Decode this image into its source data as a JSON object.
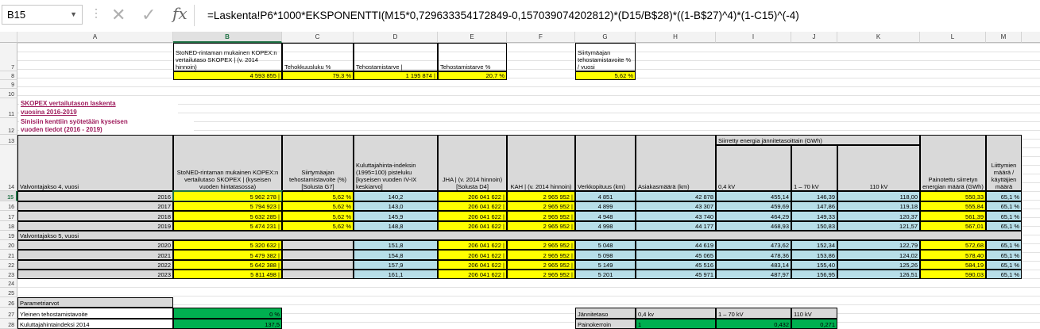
{
  "formula_bar": {
    "name_box": "B15",
    "formula": "=Laskenta!P6*1000*EKSPONENTTI(M15*0,729633354172849-0,157039074202812)*(D15/B$28)*((1-B$27)^4)*(1-C15)^(-4)"
  },
  "columns": [
    "A",
    "B",
    "C",
    "D",
    "E",
    "F",
    "G",
    "H",
    "I",
    "J",
    "K",
    "L",
    "M"
  ],
  "rows": [
    "7",
    "8",
    "9",
    "10",
    "11",
    "12",
    "13",
    "14",
    "15",
    "16",
    "17",
    "18",
    "19",
    "20",
    "21",
    "22",
    "23",
    "24",
    "25",
    "26",
    "27",
    "28"
  ],
  "top_block": {
    "b7": "StoNED-rintaman mukainen KOPEX:n vertailutaso SKOPEX | (v. 2014 hinnoin)",
    "c7": "Tehokkuusluku %",
    "d7": "Tehostamistarve |",
    "e7": "Tehostamistarve %",
    "g7": "Siirtymäajan tehostamistavoite % / vuosi",
    "b8": "4 593 855 |",
    "c8": "79,3 %",
    "d8": "1 195 874 |",
    "e8": "20,7 %",
    "g8": "5,62 %"
  },
  "section_title": {
    "line1": "SKOPEX vertailutason laskenta",
    "line2": "vuosina 2016-2019",
    "line3": "Sinisiin kenttiin syötetään kyseisen",
    "line4": "vuoden tiedot (2016 - 2019)"
  },
  "headers": {
    "a14": "Valvontajakso 4,   vuosi",
    "b14": "StoNED-rintaman mukainen KOPEX:n vertailutaso SKOPEX | (kyseisen vuoden hintatasossa)",
    "c14": "Siirtymäajan tehostamistavoite (%) [Solusta G7]",
    "d14": "Kuluttajahinta-indeksin (1995=100) pisteluku [kyseisen vuoden IV-IX keskiarvo]",
    "e14": "JHA | (v. 2014 hinnoin) [Solusta D4]",
    "f14": "KAH | (v. 2014 hinnoin)",
    "g14": "Verkkopituus (km)",
    "h14": "Asiakasmäärä (km)",
    "i13": "Siirretty energia jännitetasoittain (GWh)",
    "i14": "0,4 kV",
    "j14": "1 – 70 kV",
    "k14": "110 kV",
    "l14": "Painotettu siirretyn energian määrä (GWh)",
    "m14": "Liittymien määrä / käyttäjien määrä"
  },
  "period4": [
    {
      "year": "2016",
      "b": "5 962 278 |",
      "c": "5,62 %",
      "d": "140,2",
      "e": "206 041 622 |",
      "f": "2 965 952 |",
      "g": "4 851",
      "h": "42 878",
      "i": "455,14",
      "j": "146,39",
      "k": "118,00",
      "l": "550,33",
      "m": "65,1 %"
    },
    {
      "year": "2017",
      "b": "5 794 923 |",
      "c": "5,62 %",
      "d": "143,0",
      "e": "206 041 622 |",
      "f": "2 965 952 |",
      "g": "4 899",
      "h": "43 307",
      "i": "459,69",
      "j": "147,86",
      "k": "119,18",
      "l": "555,84",
      "m": "65,1 %"
    },
    {
      "year": "2018",
      "b": "5 632 285 |",
      "c": "5,62 %",
      "d": "145,9",
      "e": "206 041 622 |",
      "f": "2 965 952 |",
      "g": "4 948",
      "h": "43 740",
      "i": "464,29",
      "j": "149,33",
      "k": "120,37",
      "l": "561,39",
      "m": "65,1 %"
    },
    {
      "year": "2019",
      "b": "5 474 231 |",
      "c": "5,62 %",
      "d": "148,8",
      "e": "206 041 622 |",
      "f": "2 965 952 |",
      "g": "4 998",
      "h": "44 177",
      "i": "468,93",
      "j": "150,83",
      "k": "121,57",
      "l": "567,01",
      "m": "65,1 %"
    }
  ],
  "period5_label": "Valvontajakso 5,   vuosi",
  "period5": [
    {
      "year": "2020",
      "b": "5 320 632 |",
      "c": "",
      "d": "151,8",
      "e": "206 041 622 |",
      "f": "2 965 952 |",
      "g": "5 048",
      "h": "44 619",
      "i": "473,62",
      "j": "152,34",
      "k": "122,79",
      "l": "572,68",
      "m": "65,1 %"
    },
    {
      "year": "2021",
      "b": "5 479 382 |",
      "c": "",
      "d": "154,8",
      "e": "206 041 622 |",
      "f": "2 965 952 |",
      "g": "5 098",
      "h": "45 065",
      "i": "478,36",
      "j": "153,86",
      "k": "124,02",
      "l": "578,40",
      "m": "65,1 %"
    },
    {
      "year": "2022",
      "b": "5 642 388 |",
      "c": "",
      "d": "157,9",
      "e": "206 041 622 |",
      "f": "2 965 952 |",
      "g": "5 149",
      "h": "45 516",
      "i": "483,14",
      "j": "155,40",
      "k": "125,26",
      "l": "584,19",
      "m": "65,1 %"
    },
    {
      "year": "2023",
      "b": "5 811 498 |",
      "c": "",
      "d": "161,1",
      "e": "206 041 622 |",
      "f": "2 965 952 |",
      "g": "5 201",
      "h": "45 971",
      "i": "487,97",
      "j": "156,95",
      "k": "126,51",
      "l": "590,03",
      "m": "65,1 %"
    }
  ],
  "params": {
    "title": "Parametriarvot",
    "r27_label": "Yleinen tehostamistavoite",
    "r27_value": "0 %",
    "r28_label": "Kuluttajahintaindeksi 2014",
    "r28_value": "137,5"
  },
  "voltage": {
    "label1": "Jännitetaso",
    "v1": "0,4 kv",
    "v2": "1 – 70 kV",
    "v3": "110 kV",
    "label2": "Painokerroin",
    "w1": "1",
    "w2": "0,432",
    "w3": "0,271"
  },
  "colors": {
    "yellow": "#ffff00",
    "blue": "#b7dee8",
    "grey": "#d9d9d9",
    "green": "#00b050",
    "title": "#9e1b5c",
    "excel_green": "#217346"
  },
  "icons": [
    "cancel-icon",
    "confirm-icon",
    "function-icon"
  ]
}
